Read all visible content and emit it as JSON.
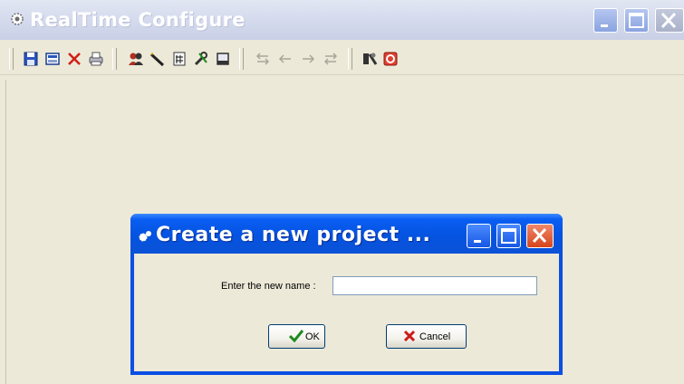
{
  "window": {
    "title": "RealTime Configure"
  },
  "toolbar": {
    "icons": [
      "save-icon",
      "floppy-page-icon",
      "delete-icon",
      "print-icon",
      "users-icon",
      "pencil-icon",
      "grid-doc-icon",
      "tools-icon",
      "window-icon",
      "swap-icon",
      "left-arrow-icon",
      "right-arrow-icon",
      "swap-alt-icon",
      "run-icon",
      "stop-icon"
    ]
  },
  "dialog": {
    "title": "Create a new project ...",
    "name_label": "Enter the new name :",
    "name_value": "",
    "ok_label": "OK",
    "cancel_label": "Cancel"
  },
  "colors": {
    "dialog_title": "#0553e1",
    "background": "#ece9d8",
    "ok_check": "#1d8a1d",
    "cancel_x": "#cc1a1a"
  }
}
